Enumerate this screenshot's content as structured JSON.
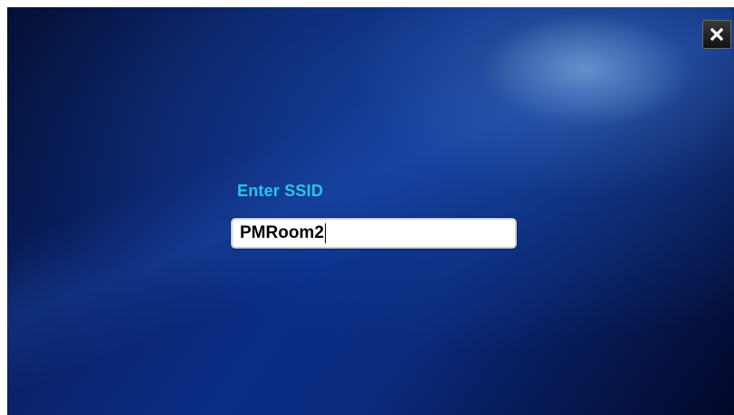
{
  "dialog": {
    "label": "Enter SSID",
    "ssid_value": "PMRoom2"
  },
  "controls": {
    "close_icon": "close-icon"
  },
  "colors": {
    "label": "#2cc3ea",
    "background_dark": "#03082a",
    "background_mid": "#0a2d86",
    "input_bg": "#ffffff"
  }
}
